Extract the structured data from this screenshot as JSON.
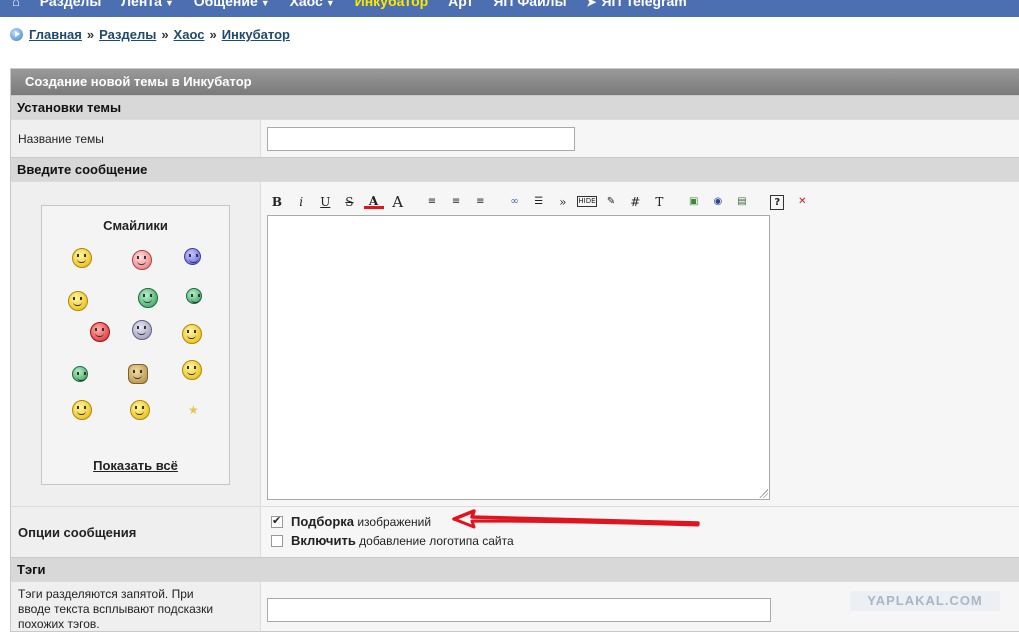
{
  "nav": {
    "items": [
      {
        "label": "Разделы",
        "caret": false,
        "active": false
      },
      {
        "label": "Лента",
        "caret": true,
        "active": false
      },
      {
        "label": "Общение",
        "caret": true,
        "active": false
      },
      {
        "label": "Хаос",
        "caret": true,
        "active": false
      },
      {
        "label": "Инкубатор",
        "caret": false,
        "active": true
      },
      {
        "label": "Арт",
        "caret": false,
        "active": false
      },
      {
        "label": "ЯП Файлы",
        "caret": false,
        "active": false
      },
      {
        "label": "ЯП Telegram",
        "caret": false,
        "active": false
      }
    ],
    "home_icon": "home-icon",
    "telegram_icon": "telegram-icon"
  },
  "breadcrumb": {
    "items": [
      "Главная",
      "Разделы",
      "Хаос",
      "Инкубатор"
    ],
    "separator": "»"
  },
  "form": {
    "title": "Создание новой темы в Инкубатор",
    "settings_head": "Установки темы",
    "topic_name_label": "Название темы",
    "topic_name_value": "",
    "message_head": "Введите сообщение",
    "smilies_title": "Смайлики",
    "show_all": "Показать всё",
    "toolbar": [
      "B",
      "i",
      "U",
      "S",
      "A",
      "A",
      "align-left",
      "align-center",
      "align-right",
      "link",
      "list",
      "»",
      "HIDE",
      "edit",
      "#",
      "T",
      "image",
      "flash",
      "video",
      "help",
      "×"
    ],
    "message_value": "",
    "options_label": "Опции сообщения",
    "option1_bold": "Подборка",
    "option1_rest": " изображений",
    "option1_checked": true,
    "option2_bold": "Включить",
    "option2_rest": " добавление логотипа сайта",
    "option2_checked": false,
    "tags_head": "Тэги",
    "tags_hint": "Тэги разделяются запятой. При вводе текста всплывают подсказки похожих тэгов.",
    "tags_value": ""
  },
  "watermark": "YAPLAKAL.COM",
  "colors": {
    "nav_bg": "#4b6fb1",
    "nav_active": "#ffe600",
    "arrow": "#e0141e"
  }
}
